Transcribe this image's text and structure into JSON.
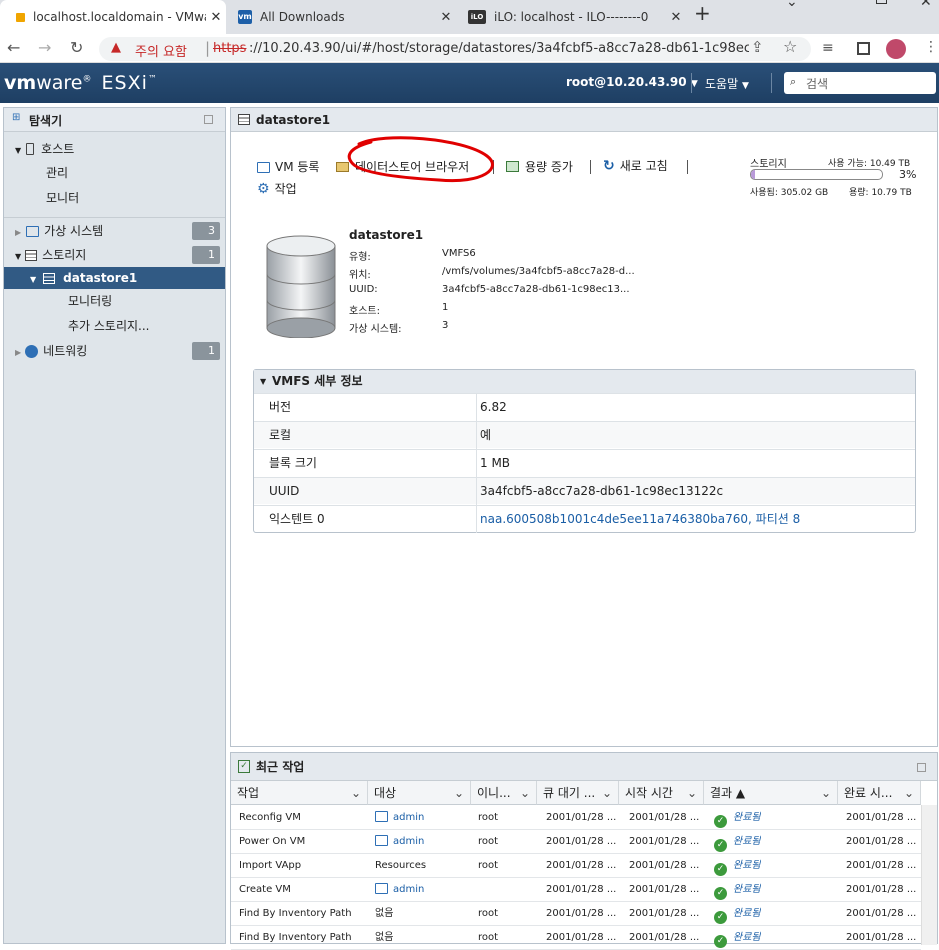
{
  "browser": {
    "tabs": [
      {
        "title": "localhost.localdomain - VMware",
        "favicon_color": "#f0a500",
        "active": true
      },
      {
        "title": "All Downloads",
        "favicon_text": "vm",
        "favicon_color": "#1d5fa8",
        "active": false
      },
      {
        "title": "iLO: localhost - ILO--------0",
        "favicon_text": "iLO",
        "favicon_color": "#333",
        "active": false
      }
    ],
    "new_tab": "+",
    "security_label": "주의 요함",
    "url_scheme": "https",
    "url_rest": "://10.20.43.90/ui/#/host/storage/datastores/3a4fcbf5-a8cc7a28-db61-1c98ec..."
  },
  "header": {
    "brand_vm": "vm",
    "brand_ware": "ware",
    "brand_esxi": "ESXi",
    "user": "root@10.20.43.90",
    "help": "도움말",
    "search_placeholder": "검색"
  },
  "nav": {
    "title": "탐색기",
    "host": "호스트",
    "host_manage": "관리",
    "host_monitor": "모니터",
    "vms": "가상 시스템",
    "vms_count": "3",
    "storage": "스토리지",
    "storage_count": "1",
    "datastore": "datastore1",
    "ds_monitor": "모니터링",
    "ds_more": "추가 스토리지...",
    "network": "네트워킹",
    "network_count": "1"
  },
  "main": {
    "title": "datastore1",
    "toolbar": {
      "register_vm": "VM 등록",
      "datastore_browser": "데이터스토어 브라우저",
      "increase_capacity": "용량 증가",
      "refresh": "새로 고침",
      "actions": "작업"
    },
    "storage_summary": {
      "label": "스토리지",
      "free_label": "사용 가능: 10.49 TB",
      "percent": "3%",
      "used": "사용됨: 305.02 GB",
      "capacity": "용량: 10.79 TB",
      "used_fraction": 0.03
    },
    "datastore_info": {
      "name": "datastore1",
      "rows": [
        {
          "k": "유형:",
          "v": "VMFS6"
        },
        {
          "k": "위치:",
          "v": "/vmfs/volumes/3a4fcbf5-a8cc7a28-d..."
        },
        {
          "k": "UUID:",
          "v": "3a4fcbf5-a8cc7a28-db61-1c98ec13..."
        },
        {
          "k": "호스트:",
          "v": "1"
        },
        {
          "k": "가상 시스템:",
          "v": "3"
        }
      ]
    },
    "vmfs": {
      "title": "VMFS 세부 정보",
      "rows": [
        {
          "k": "버전",
          "v": "6.82"
        },
        {
          "k": "로컬",
          "v": "예"
        },
        {
          "k": "블록 크기",
          "v": "1 MB"
        },
        {
          "k": "UUID",
          "v": "3a4fcbf5-a8cc7a28-db61-1c98ec13122c"
        },
        {
          "k": "익스텐트 0",
          "v": "naa.600508b1001c4de5ee11a746380ba760, 파티션 8"
        }
      ]
    }
  },
  "tasks": {
    "title": "최근 작업",
    "columns": [
      "작업",
      "대상",
      "이니...",
      "큐 대기 ...",
      "시작 시간",
      "결과 ▲",
      "완료 시..."
    ],
    "rows": [
      {
        "task": "Reconfig VM",
        "target": "admin",
        "target_link": true,
        "init": "root",
        "queued": "2001/01/28 ...",
        "start": "2001/01/28 ...",
        "result": "완료됨",
        "done": "2001/01/28 ..."
      },
      {
        "task": "Power On VM",
        "target": "admin",
        "target_link": true,
        "init": "root",
        "queued": "2001/01/28 ...",
        "start": "2001/01/28 ...",
        "result": "완료됨",
        "done": "2001/01/28 ..."
      },
      {
        "task": "Import VApp",
        "target": "Resources",
        "target_link": false,
        "init": "root",
        "queued": "2001/01/28 ...",
        "start": "2001/01/28 ...",
        "result": "완료됨",
        "done": "2001/01/28 ..."
      },
      {
        "task": "Create VM",
        "target": "admin",
        "target_link": true,
        "init": "",
        "queued": "2001/01/28 ...",
        "start": "2001/01/28 ...",
        "result": "완료됨",
        "done": "2001/01/28 ..."
      },
      {
        "task": "Find By Inventory Path",
        "target": "없음",
        "target_link": false,
        "init": "root",
        "queued": "2001/01/28 ...",
        "start": "2001/01/28 ...",
        "result": "완료됨",
        "done": "2001/01/28 ..."
      },
      {
        "task": "Find By Inventory Path",
        "target": "없음",
        "target_link": false,
        "init": "root",
        "queued": "2001/01/28 ...",
        "start": "2001/01/28 ...",
        "result": "완료됨",
        "done": "2001/01/28 ..."
      }
    ]
  },
  "annotation_color": "#e00000"
}
